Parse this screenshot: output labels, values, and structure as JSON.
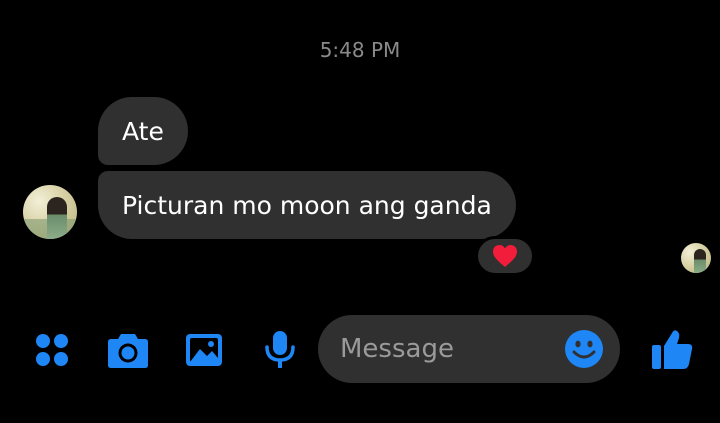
{
  "conversation": {
    "timestamp": "5:48 PM",
    "messages": [
      {
        "text": "Ate"
      },
      {
        "text": "Picturan mo moon ang ganda"
      }
    ],
    "reaction": "heart"
  },
  "composer": {
    "placeholder": "Message"
  },
  "toolbar": {
    "icons": [
      "apps-icon",
      "camera-icon",
      "image-icon",
      "microphone-icon"
    ],
    "send_icon": "thumbs-up-icon",
    "emoji_icon": "emoji-icon"
  },
  "colors": {
    "background": "#000000",
    "bubble": "#303030",
    "accent": "#1e86f5",
    "reaction": "#f21d3b",
    "timestamp": "#8a8a8a"
  }
}
